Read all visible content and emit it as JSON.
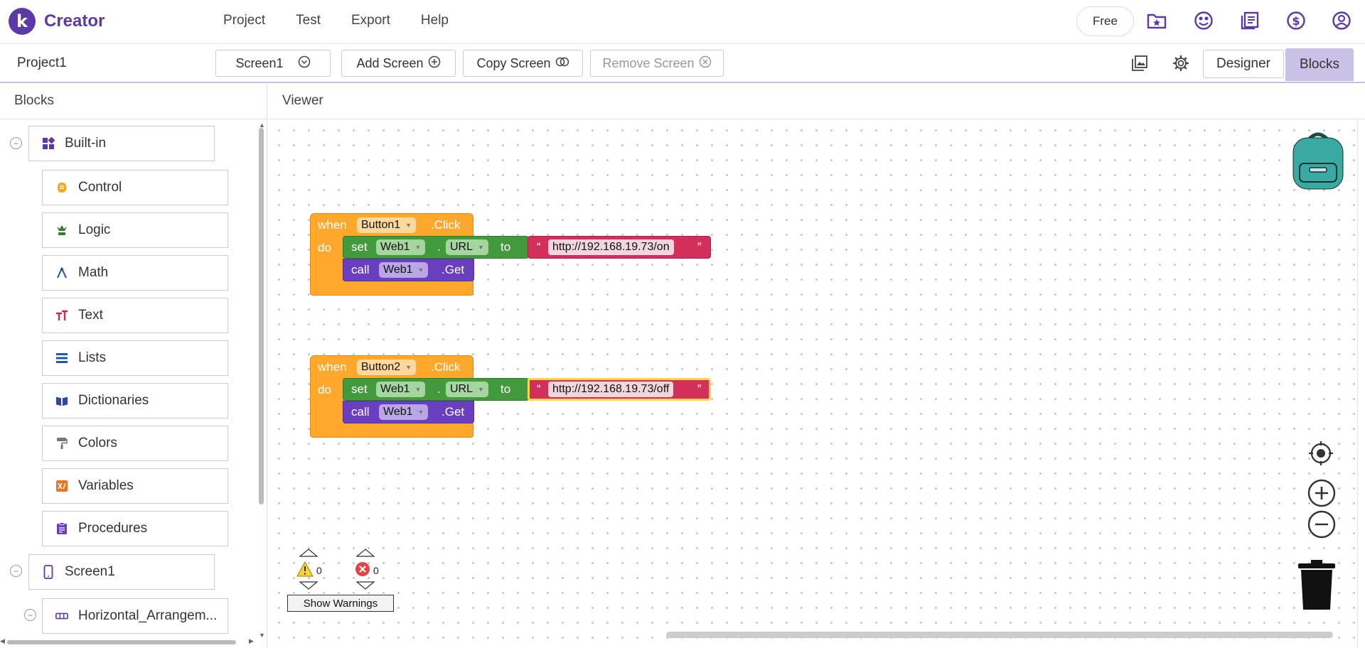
{
  "app": {
    "logo_letter": "k",
    "name": "Creator",
    "brand_color": "#5b3aa8"
  },
  "menu": [
    "Project",
    "Test",
    "Export",
    "Help"
  ],
  "account": {
    "plan_label": "Free",
    "icons": [
      "my-projects-folder-icon",
      "gallery-icon",
      "docs-icon",
      "pricing-icon",
      "user-account-icon"
    ]
  },
  "project": {
    "name": "Project1",
    "screen_select": "Screen1",
    "add_screen": "Add Screen",
    "copy_screen": "Copy Screen",
    "remove_screen": "Remove Screen",
    "designer": "Designer",
    "blocks": "Blocks"
  },
  "blocks_panel": {
    "title": "Blocks",
    "builtin_label": "Built-in",
    "builtin_items": [
      {
        "label": "Control",
        "color": "#f5a623"
      },
      {
        "label": "Logic",
        "color": "#3d7a3a"
      },
      {
        "label": "Math",
        "color": "#1e4f9c"
      },
      {
        "label": "Text",
        "color": "#c22b4d"
      },
      {
        "label": "Lists",
        "color": "#1e5aa8"
      },
      {
        "label": "Dictionaries",
        "color": "#2b4aa0"
      },
      {
        "label": "Colors",
        "color": "#777777"
      },
      {
        "label": "Variables",
        "color": "#e8741e"
      },
      {
        "label": "Procedures",
        "color": "#6a3fbf"
      }
    ],
    "screen_label": "Screen1",
    "component_label": "Horizontal_Arrangem..."
  },
  "viewer": {
    "title": "Viewer",
    "events": [
      {
        "when": "when",
        "component": "Button1",
        "event": ".Click",
        "do": "do",
        "set": "set",
        "set_component": "Web1",
        "dot": ".",
        "property": "URL",
        "to": "to",
        "open_quote": "“",
        "string": "http://192.168.19.73/on",
        "close_quote": "”",
        "call": "call",
        "call_component": "Web1",
        "method": ".Get"
      },
      {
        "when": "when",
        "component": "Button2",
        "event": ".Click",
        "do": "do",
        "set": "set",
        "set_component": "Web1",
        "dot": ".",
        "property": "URL",
        "to": "to",
        "open_quote": "“",
        "string": "http://192.168.19.73/off",
        "close_quote": "”",
        "call": "call",
        "call_component": "Web1",
        "method": ".Get"
      }
    ],
    "warnings": {
      "warning_count": "0",
      "error_count": "0",
      "toggle_label": "Show Warnings"
    }
  }
}
